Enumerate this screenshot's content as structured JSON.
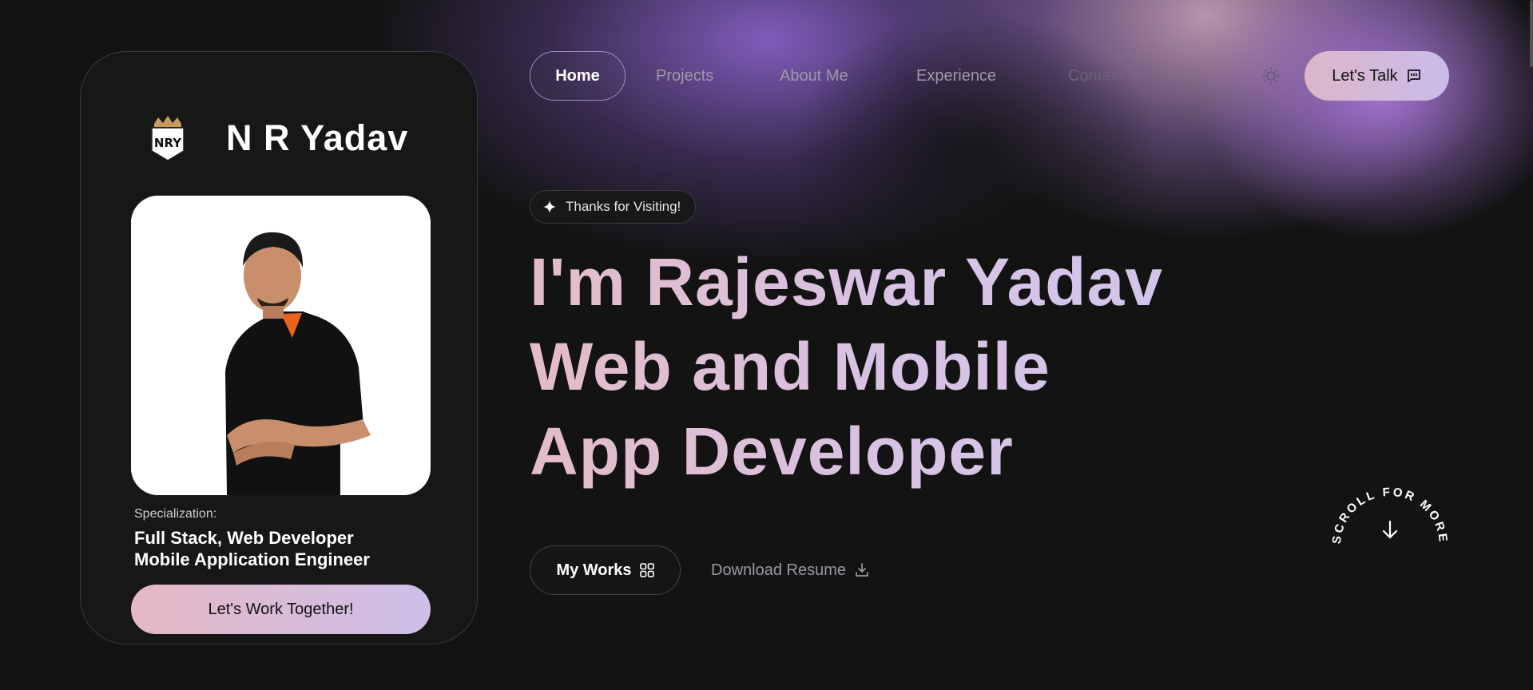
{
  "brand": {
    "name": "N R Yadav",
    "logo_text": "NRY"
  },
  "nav": {
    "items": [
      {
        "label": "Home"
      },
      {
        "label": "Projects"
      },
      {
        "label": "About Me"
      },
      {
        "label": "Experience"
      },
      {
        "label": "Contact"
      }
    ],
    "cta_label": "Let's Talk",
    "cta_icon": "message-icon",
    "theme_icon": "sun-icon"
  },
  "profile": {
    "specialization_label": "Specialization:",
    "specialization_lines": [
      "Full Stack, Web Developer",
      "Mobile Application Engineer"
    ],
    "cta_label": "Let's Work Together!"
  },
  "hero": {
    "badge": "Thanks for Visiting!",
    "title_lines": [
      "I'm Rajeswar Yadav",
      "Web and Mobile",
      "App Developer"
    ],
    "primary_button": "My Works",
    "secondary_link": "Download Resume"
  },
  "scroll": {
    "text": "SCROLL FOR MORE"
  },
  "colors": {
    "background": "#131313",
    "accent_gradient_start": "#e4b8c4",
    "accent_gradient_end": "#cdbfe9",
    "glow_purple": "#8660c4"
  }
}
